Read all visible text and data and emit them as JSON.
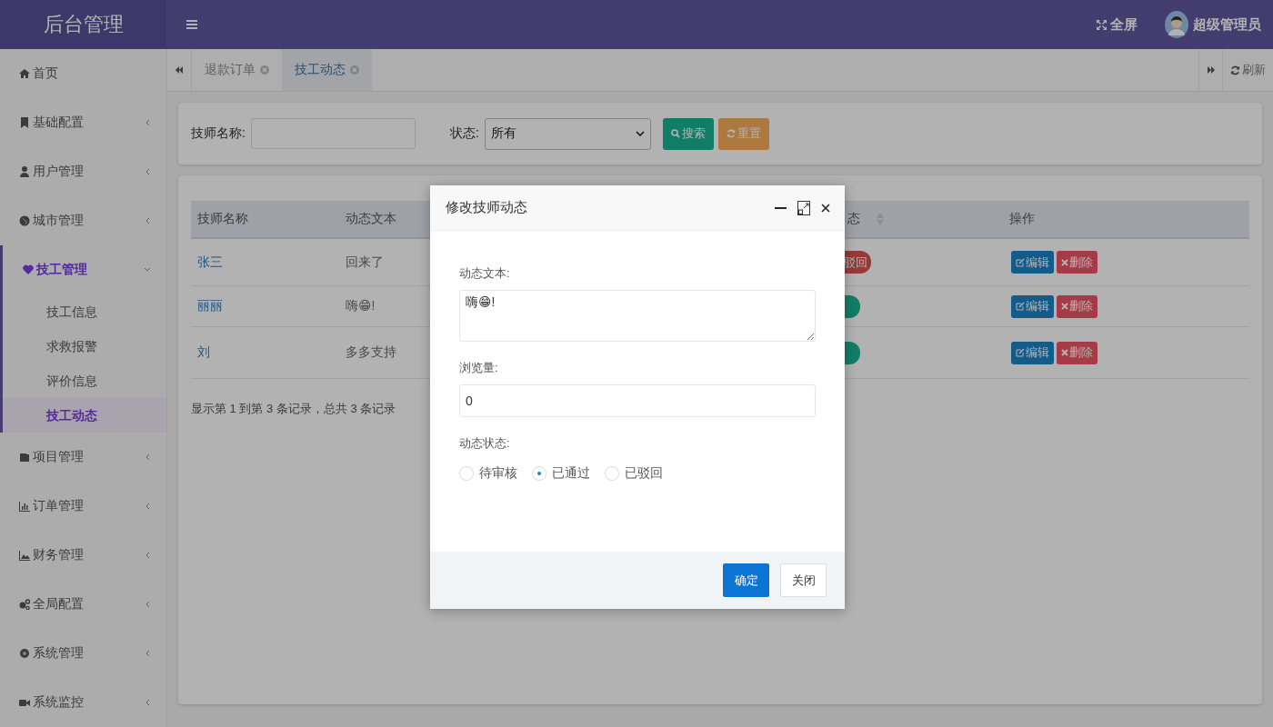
{
  "brand": {
    "title": "后台管理"
  },
  "header": {
    "fullscreen": "全屏",
    "user": "超级管理员"
  },
  "sidebar": {
    "items": [
      {
        "label": "首页",
        "kind": "link",
        "expanded": false
      },
      {
        "label": "基础配置",
        "kind": "group",
        "expanded": false
      },
      {
        "label": "用户管理",
        "kind": "group",
        "expanded": false
      },
      {
        "label": "城市管理",
        "kind": "group",
        "expanded": false
      },
      {
        "label": "技工管理",
        "kind": "group",
        "expanded": true,
        "children": [
          {
            "label": "技工信息",
            "selected": false
          },
          {
            "label": "求救报警",
            "selected": false
          },
          {
            "label": "评价信息",
            "selected": false
          },
          {
            "label": "技工动态",
            "selected": true
          }
        ]
      },
      {
        "label": "项目管理",
        "kind": "group",
        "expanded": false
      },
      {
        "label": "订单管理",
        "kind": "group",
        "expanded": false
      },
      {
        "label": "财务管理",
        "kind": "group",
        "expanded": false
      },
      {
        "label": "全局配置",
        "kind": "group",
        "expanded": false
      },
      {
        "label": "系统管理",
        "kind": "group",
        "expanded": false
      },
      {
        "label": "系统监控",
        "kind": "group",
        "expanded": false
      }
    ]
  },
  "tabs": [
    {
      "label": "退款订单",
      "selected": false
    },
    {
      "label": "技工动态",
      "selected": true
    }
  ],
  "refresh": "刷新",
  "search": {
    "name_label": "技师名称:",
    "status_label": "状态:",
    "status_value": "所有",
    "search_button": "搜索",
    "reset_button": "重置"
  },
  "table": {
    "columns": [
      {
        "label": "技师名称"
      },
      {
        "label": "动态文本"
      },
      {
        "label": "态",
        "sortable": true
      },
      {
        "label": "操作"
      }
    ],
    "rows": [
      {
        "name": "张三",
        "text": "回来了",
        "status": {
          "kind": "rejected",
          "label": "驳回"
        },
        "actions": [
          "编辑",
          "删除"
        ]
      },
      {
        "name": "丽丽",
        "text": "嗨😁!",
        "status": {
          "kind": "approved"
        },
        "actions": [
          "编辑",
          "删除"
        ]
      },
      {
        "name": "刘",
        "text": "多多支持",
        "status": {
          "kind": "approved"
        },
        "actions": [
          "编辑",
          "删除"
        ]
      }
    ],
    "footer": "显示第 1 到第 3 条记录，总共 3 条记录"
  },
  "modal": {
    "title": "修改技师动态",
    "text_label": "动态文本:",
    "text_value": "嗨😁!",
    "views_label": "浏览量:",
    "views_value": "0",
    "status_label": "动态状态:",
    "status_options": [
      {
        "label": "待审核",
        "selected": false
      },
      {
        "label": "已通过",
        "selected": true
      },
      {
        "label": "已驳回",
        "selected": false
      }
    ],
    "ok_button": "确定",
    "close_button": "关闭"
  }
}
